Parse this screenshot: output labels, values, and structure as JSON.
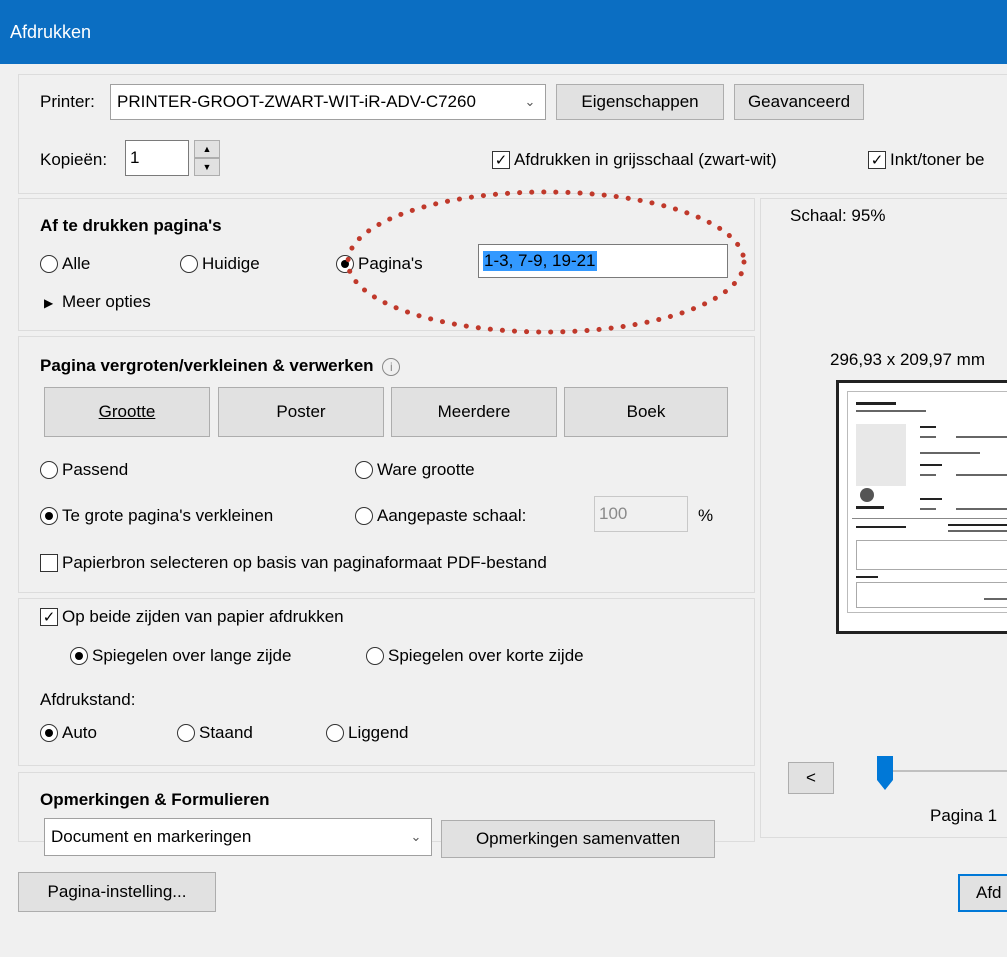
{
  "window": {
    "title": "Afdrukken"
  },
  "printer": {
    "label": "Printer:",
    "selected": "PRINTER-GROOT-ZWART-WIT-iR-ADV-C7260",
    "properties_button": "Eigenschappen",
    "advanced_button": "Geavanceerd"
  },
  "copies": {
    "label": "Kopieën:",
    "value": "1"
  },
  "grayscale_check": {
    "label": "Afdrukken in grijsschaal (zwart-wit)",
    "checked": true
  },
  "ink_check": {
    "label": "Inkt/toner be",
    "checked": true
  },
  "pages": {
    "heading": "Af te drukken pagina's",
    "option_all": "Alle",
    "option_current": "Huidige",
    "option_pages": "Pagina's",
    "pages_value": "1-3, 7-9, 19-21",
    "more_options": "Meer opties",
    "annotation_color": "#c0392b"
  },
  "sizing": {
    "heading": "Pagina vergroten/verkleinen & verwerken",
    "btn_size": "Grootte",
    "btn_poster": "Poster",
    "btn_multiple": "Meerdere",
    "btn_book": "Boek",
    "fit": "Passend",
    "actual": "Ware grootte",
    "shrink": "Te grote pagina's verkleinen",
    "custom": "Aangepaste schaal:",
    "custom_value": "100",
    "percent": "%",
    "paper_source": "Papierbron selecteren op basis van paginaformaat PDF-bestand"
  },
  "duplex": {
    "label": "Op beide zijden van papier afdrukken",
    "long": "Spiegelen over lange zijde",
    "short": "Spiegelen over korte zijde",
    "orientation_label": "Afdrukstand:",
    "auto": "Auto",
    "portrait": "Staand",
    "landscape": "Liggend"
  },
  "comments": {
    "heading": "Opmerkingen & Formulieren",
    "selected": "Document en markeringen",
    "summarize_button": "Opmerkingen samenvatten"
  },
  "preview": {
    "scale": "Schaal:  95%",
    "dimensions": "296,93 x 209,97 mm",
    "prev_button": "<",
    "page_label": "Pagina 1"
  },
  "footer": {
    "page_setup_button": "Pagina-instelling...",
    "print_button": "Afd"
  },
  "colors": {
    "title_bar": "#0b6ec2",
    "focus": "#0078d7",
    "selection": "#3399ff",
    "slider": "#0078d7"
  }
}
